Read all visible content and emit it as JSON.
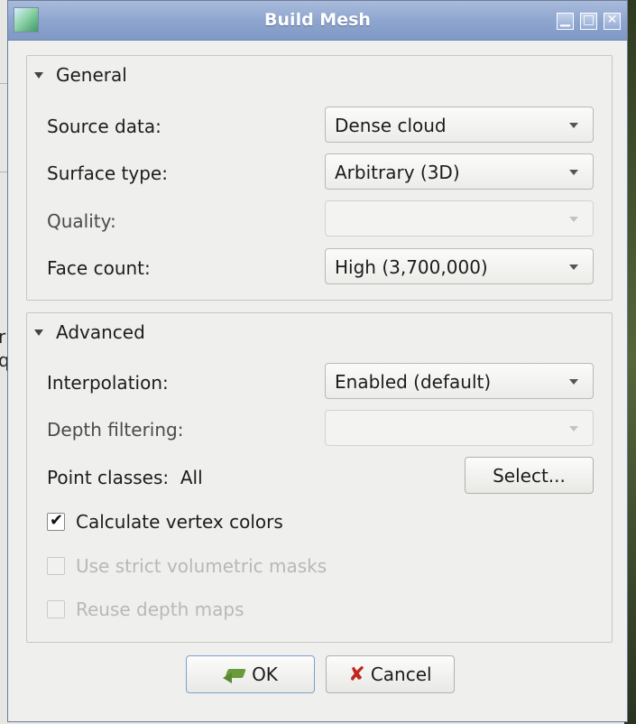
{
  "window": {
    "title": "Build Mesh"
  },
  "background": {
    "left_chars": "r\nq"
  },
  "general": {
    "title": "General",
    "source_data": {
      "label": "Source data:",
      "value": "Dense cloud"
    },
    "surface_type": {
      "label": "Surface type:",
      "value": "Arbitrary (3D)"
    },
    "quality": {
      "label": "Quality:",
      "value": ""
    },
    "face_count": {
      "label": "Face count:",
      "value": "High (3,700,000)"
    }
  },
  "advanced": {
    "title": "Advanced",
    "interpolation": {
      "label": "Interpolation:",
      "value": "Enabled (default)"
    },
    "depth_filtering": {
      "label": "Depth filtering:",
      "value": ""
    },
    "point_classes": {
      "label": "Point classes:",
      "value": "All",
      "button": "Select..."
    },
    "calc_vertex_colors": {
      "label": "Calculate vertex colors",
      "checked": true
    },
    "strict_masks": {
      "label": "Use strict volumetric masks",
      "checked": false,
      "enabled": false
    },
    "reuse_depth": {
      "label": "Reuse depth maps",
      "checked": false,
      "enabled": false
    }
  },
  "buttons": {
    "ok": "OK",
    "cancel": "Cancel"
  },
  "colors": {
    "titlebar": "#8ea6cf",
    "dialog_bg": "#efefed",
    "cancel_icon": "#c0271f"
  }
}
